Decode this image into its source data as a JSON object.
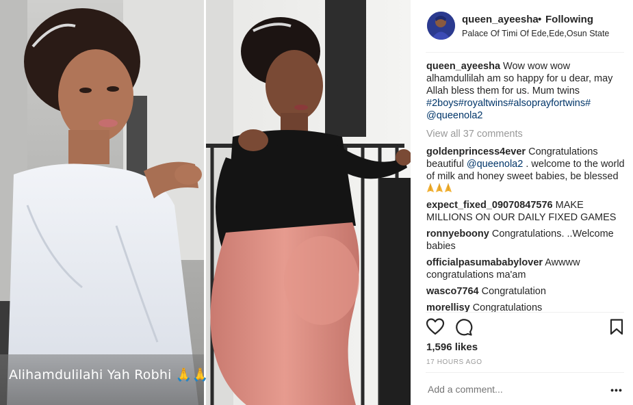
{
  "post": {
    "caption_overlay": "Alihamdulilahi Yah  Robhi 🙏🙏"
  },
  "header": {
    "username": "queen_ayeesha",
    "separator": "•",
    "follow_status": "Following",
    "location": "Palace Of Timi Of Ede,Ede,Osun State"
  },
  "caption": {
    "user": "queen_ayeesha",
    "text": "Wow wow wow alhamdullilah am so happy for u dear, may Allah bless them for us. Mum twins ",
    "tags": "#2boys#royaltwins#alsoprayfortwins#",
    "mention": "@queenola2"
  },
  "view_all_comments": "View all 37 comments",
  "comments": [
    {
      "user": "goldenprincess4ever",
      "text_before": "Congratulations beautiful ",
      "mention": "@queenola2",
      "text_after": " . welcome to the world of milk and honey sweet babies, be blessed "
    },
    {
      "user": "expect_fixed_09070847576",
      "text": "MAKE MILLIONS ON OUR DAILY FIXED GAMES"
    },
    {
      "user": "ronnyeboony",
      "text": "Congratulations. ..Welcome babies"
    },
    {
      "user": "officialpasumababylover",
      "text": "Awwww congratulations ma'am"
    },
    {
      "user": "wasco7764",
      "text": "Congratulation"
    },
    {
      "user": "morellisy",
      "text": "Congratulations"
    }
  ],
  "likes": "1,596 likes",
  "timestamp": "17 HOURS AGO",
  "add_comment": {
    "placeholder": "Add a comment..."
  },
  "more_options": "•••",
  "colors": {
    "link": "#003569",
    "muted": "#999999",
    "text": "#262626",
    "divider": "#efefef"
  },
  "icons": [
    "heart-icon",
    "comment-bubble-icon",
    "bookmark-icon",
    "prayer-hands-icon"
  ]
}
